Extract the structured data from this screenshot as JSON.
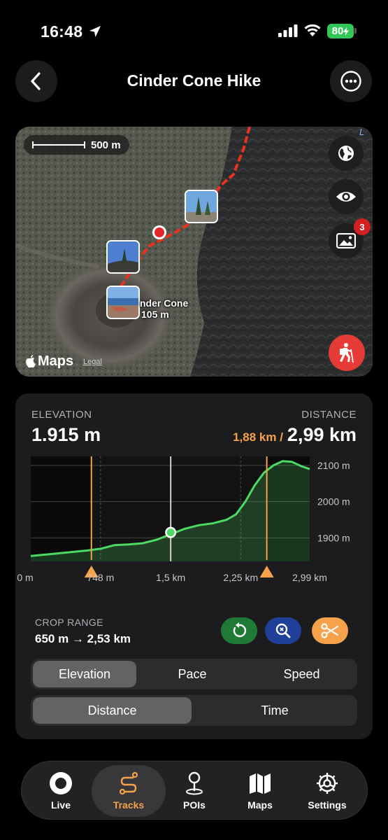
{
  "status": {
    "time": "16:48",
    "battery": "80"
  },
  "header": {
    "title": "Cinder Cone Hike"
  },
  "map": {
    "scale_label": "500 m",
    "place_name": "nder Cone",
    "place_elev": "105 m",
    "attribution": "Maps",
    "legal": "Legal",
    "photo_badge": "3",
    "corner_text": "L",
    "icons": [
      "globe-icon",
      "eye-icon",
      "photo-icon",
      "hiker-icon"
    ]
  },
  "elevation": {
    "elevation_label": "ELEVATION",
    "elevation_value": "1.915 m",
    "distance_label": "DISTANCE",
    "distance_partial": "1,88 km /",
    "distance_total": "2,99 km"
  },
  "chart_data": {
    "type": "area",
    "x": [
      0,
      0.2,
      0.4,
      0.6,
      0.75,
      0.9,
      1.05,
      1.2,
      1.35,
      1.5,
      1.65,
      1.8,
      1.95,
      2.1,
      2.2,
      2.3,
      2.4,
      2.5,
      2.6,
      2.7,
      2.8,
      2.9,
      2.99
    ],
    "y": [
      1850,
      1855,
      1860,
      1865,
      1870,
      1880,
      1882,
      1885,
      1895,
      1910,
      1925,
      1935,
      1940,
      1950,
      1965,
      2000,
      2045,
      2080,
      2100,
      2112,
      2110,
      2098,
      2090
    ],
    "x_ticks": [
      "0 m",
      "748 m",
      "1,5 km",
      "2,25 km",
      "2,99 km"
    ],
    "y_ticks": [
      "2100 m",
      "2000 m",
      "1900 m"
    ],
    "xlim": [
      0,
      2.99
    ],
    "ylim": [
      1835,
      2125
    ],
    "crop_start_km": 0.65,
    "crop_end_km": 2.53,
    "cursor_km": 1.5,
    "cursor_elev": 1915,
    "colors": {
      "line": "#4cd964",
      "crop": "#f7a14a",
      "cursor": "#d0d0d0"
    }
  },
  "crop": {
    "label": "CROP RANGE",
    "value": "650 m → 2,53 km",
    "buttons": [
      {
        "icon": "reset-icon",
        "color": "#1f7a35"
      },
      {
        "icon": "zoom-icon",
        "color": "#1f3f99"
      },
      {
        "icon": "scissors-icon",
        "color": "#f7a14a"
      }
    ]
  },
  "metric_tabs": [
    "Elevation",
    "Pace",
    "Speed"
  ],
  "axis_tabs": [
    "Distance",
    "Time"
  ],
  "tabbar": {
    "items": [
      "Live",
      "Tracks",
      "POIs",
      "Maps",
      "Settings"
    ],
    "active": "Tracks"
  }
}
